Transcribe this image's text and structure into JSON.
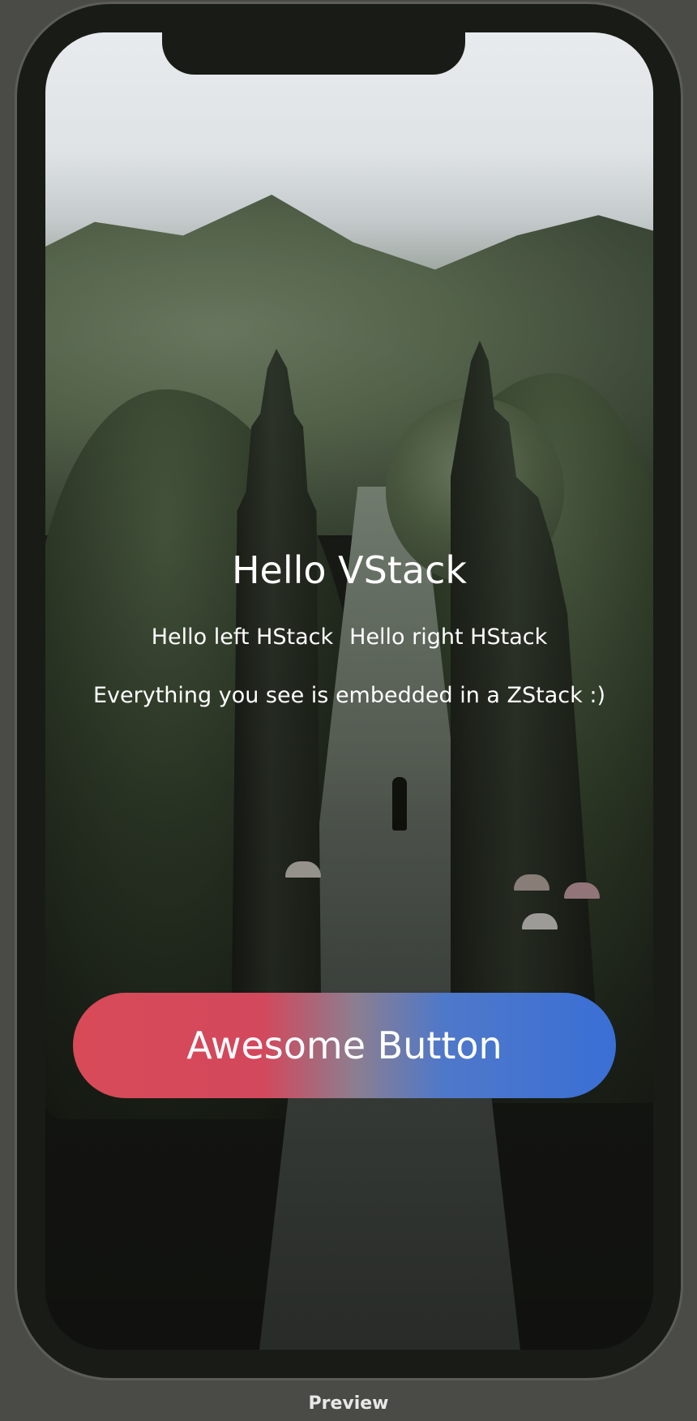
{
  "screen": {
    "title": "Hello VStack",
    "hstack_left": "Hello left HStack",
    "hstack_right": "Hello right HStack",
    "caption": "Everything you see is embedded in a ZStack :)",
    "button_label": "Awesome Button",
    "button_gradient": [
      "#d84a58",
      "#3a6fd6"
    ]
  },
  "footer": {
    "preview_label": "Preview"
  },
  "colors": {
    "canvas_bg": "#4a4a46",
    "bezel": "#191b16",
    "text": "#ffffff"
  }
}
